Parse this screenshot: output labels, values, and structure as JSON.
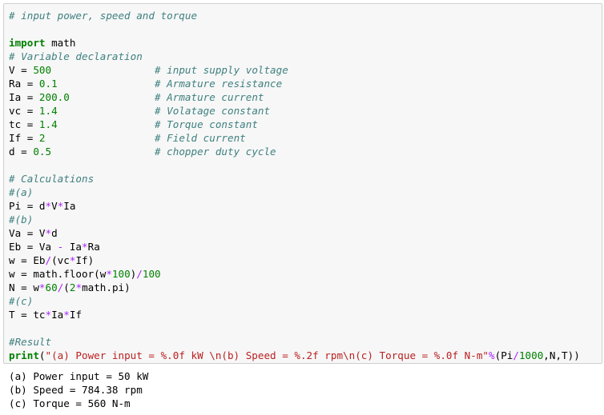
{
  "code_lines": [
    [
      {
        "t": "# input power, speed and torque",
        "k": "c"
      }
    ],
    [],
    [
      {
        "t": "import",
        "k": "k"
      },
      {
        "t": " math",
        "k": ""
      }
    ],
    [
      {
        "t": "# Variable declaration",
        "k": "c"
      }
    ],
    [
      {
        "t": "V = ",
        "k": ""
      },
      {
        "t": "500",
        "k": "num"
      },
      {
        "t": "                 ",
        "k": ""
      },
      {
        "t": "# input supply voltage",
        "k": "c"
      }
    ],
    [
      {
        "t": "Ra = ",
        "k": ""
      },
      {
        "t": "0.1",
        "k": "num"
      },
      {
        "t": "                ",
        "k": ""
      },
      {
        "t": "# Armature resistance",
        "k": "c"
      }
    ],
    [
      {
        "t": "Ia = ",
        "k": ""
      },
      {
        "t": "200.0",
        "k": "num"
      },
      {
        "t": "              ",
        "k": ""
      },
      {
        "t": "# Armature current",
        "k": "c"
      }
    ],
    [
      {
        "t": "vc = ",
        "k": ""
      },
      {
        "t": "1.4",
        "k": "num"
      },
      {
        "t": "                ",
        "k": ""
      },
      {
        "t": "# Volatage constant",
        "k": "c"
      }
    ],
    [
      {
        "t": "tc = ",
        "k": ""
      },
      {
        "t": "1.4",
        "k": "num"
      },
      {
        "t": "                ",
        "k": ""
      },
      {
        "t": "# Torque constant",
        "k": "c"
      }
    ],
    [
      {
        "t": "If = ",
        "k": ""
      },
      {
        "t": "2",
        "k": "num"
      },
      {
        "t": "                  ",
        "k": ""
      },
      {
        "t": "# Field current",
        "k": "c"
      }
    ],
    [
      {
        "t": "d = ",
        "k": ""
      },
      {
        "t": "0.5",
        "k": "num"
      },
      {
        "t": "                 ",
        "k": ""
      },
      {
        "t": "# chopper duty cycle",
        "k": "c"
      }
    ],
    [],
    [
      {
        "t": "# Calculations",
        "k": "c"
      }
    ],
    [
      {
        "t": "#(a)",
        "k": "c"
      }
    ],
    [
      {
        "t": "Pi = d",
        "k": ""
      },
      {
        "t": "*",
        "k": "o"
      },
      {
        "t": "V",
        "k": ""
      },
      {
        "t": "*",
        "k": "o"
      },
      {
        "t": "Ia",
        "k": ""
      }
    ],
    [
      {
        "t": "#(b)",
        "k": "c"
      }
    ],
    [
      {
        "t": "Va = V",
        "k": ""
      },
      {
        "t": "*",
        "k": "o"
      },
      {
        "t": "d",
        "k": ""
      }
    ],
    [
      {
        "t": "Eb = Va ",
        "k": ""
      },
      {
        "t": "-",
        "k": "o"
      },
      {
        "t": " Ia",
        "k": ""
      },
      {
        "t": "*",
        "k": "o"
      },
      {
        "t": "Ra",
        "k": ""
      }
    ],
    [
      {
        "t": "w = Eb",
        "k": ""
      },
      {
        "t": "/",
        "k": "o"
      },
      {
        "t": "(vc",
        "k": ""
      },
      {
        "t": "*",
        "k": "o"
      },
      {
        "t": "If)",
        "k": ""
      }
    ],
    [
      {
        "t": "w = math.floor(w",
        "k": ""
      },
      {
        "t": "*",
        "k": "o"
      },
      {
        "t": "100",
        "k": "num"
      },
      {
        "t": ")",
        "k": ""
      },
      {
        "t": "/",
        "k": "o"
      },
      {
        "t": "100",
        "k": "num"
      }
    ],
    [
      {
        "t": "N = w",
        "k": ""
      },
      {
        "t": "*",
        "k": "o"
      },
      {
        "t": "60",
        "k": "num"
      },
      {
        "t": "/",
        "k": "o"
      },
      {
        "t": "(",
        "k": ""
      },
      {
        "t": "2",
        "k": "num"
      },
      {
        "t": "*",
        "k": "o"
      },
      {
        "t": "math.pi)",
        "k": ""
      }
    ],
    [
      {
        "t": "#(c)",
        "k": "c"
      }
    ],
    [
      {
        "t": "T = tc",
        "k": ""
      },
      {
        "t": "*",
        "k": "o"
      },
      {
        "t": "Ia",
        "k": ""
      },
      {
        "t": "*",
        "k": "o"
      },
      {
        "t": "If",
        "k": ""
      }
    ],
    [],
    [
      {
        "t": "#Result",
        "k": "c"
      }
    ],
    [
      {
        "t": "print",
        "k": "k"
      },
      {
        "t": "(",
        "k": ""
      },
      {
        "t": "\"(a) Power input = %.0f kW \\n(b) Speed = %.2f rpm\\n(c) Torque = %.0f N-m\"",
        "k": "s"
      },
      {
        "t": "%",
        "k": "o"
      },
      {
        "t": "(Pi",
        "k": ""
      },
      {
        "t": "/",
        "k": "o"
      },
      {
        "t": "1000",
        "k": "num"
      },
      {
        "t": ",N,T))",
        "k": ""
      }
    ]
  ],
  "output_lines": [
    "(a) Power input = 50 kW",
    "(b) Speed = 784.38 rpm",
    "(c) Torque = 560 N-m"
  ]
}
